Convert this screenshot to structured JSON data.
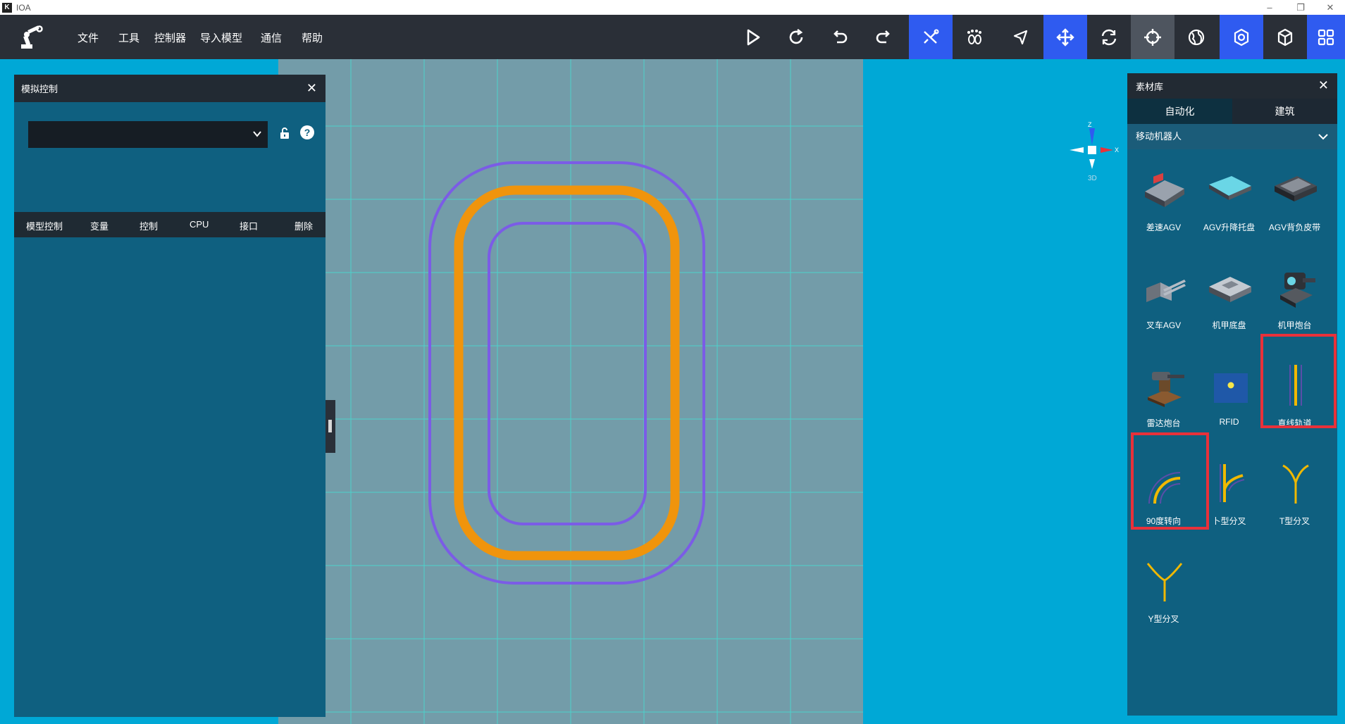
{
  "window": {
    "title": "IOA",
    "controls": [
      "–",
      "❐",
      "✕"
    ]
  },
  "menu": {
    "items": [
      "文件",
      "工具",
      "控制器",
      "导入模型",
      "通信",
      "帮助"
    ]
  },
  "toolbar": {
    "icons": [
      "play-icon",
      "refresh-icon",
      "undo-icon",
      "redo-icon",
      "path-icon",
      "paw-icon",
      "select-icon",
      "move-icon",
      "rotate-icon",
      "target-icon",
      "globe-icon",
      "settings-icon",
      "cube-icon",
      "grid-icon"
    ],
    "accent": "#2f5bf0"
  },
  "sim_panel": {
    "title": "模拟控制",
    "select_value": "",
    "tabs": [
      "模型控制",
      "变量",
      "控制",
      "CPU",
      "接口",
      "删除"
    ]
  },
  "gizmo": {
    "z_label": "Z",
    "x_label": "X",
    "mode_label": "3D"
  },
  "library": {
    "title": "素材库",
    "tabs": [
      "自动化",
      "建筑"
    ],
    "category": "移动机器人",
    "items": [
      {
        "label": "差速AGV",
        "icon": "differential-agv-icon"
      },
      {
        "label": "AGV升降托盘",
        "icon": "agv-lift-tray-icon"
      },
      {
        "label": "AGV背负皮带",
        "icon": "agv-belt-icon"
      },
      {
        "label": "叉车AGV",
        "icon": "forklift-agv-icon"
      },
      {
        "label": "机甲底盘",
        "icon": "mech-chassis-icon"
      },
      {
        "label": "机甲炮台",
        "icon": "mech-turret-icon"
      },
      {
        "label": "雷达炮台",
        "icon": "radar-turret-icon"
      },
      {
        "label": "RFID",
        "icon": "rfid-icon"
      },
      {
        "label": "直线轨道",
        "icon": "straight-track-icon"
      },
      {
        "label": "90度转向",
        "icon": "turn-90-icon"
      },
      {
        "label": "卜型分叉",
        "icon": "bu-fork-icon"
      },
      {
        "label": "T型分叉",
        "icon": "t-fork-icon"
      },
      {
        "label": "Y型分叉",
        "icon": "y-fork-icon"
      }
    ]
  },
  "colors": {
    "track_orange": "#f0940c",
    "track_purple": "#7b5ce6",
    "highlight": "#e8313a"
  }
}
